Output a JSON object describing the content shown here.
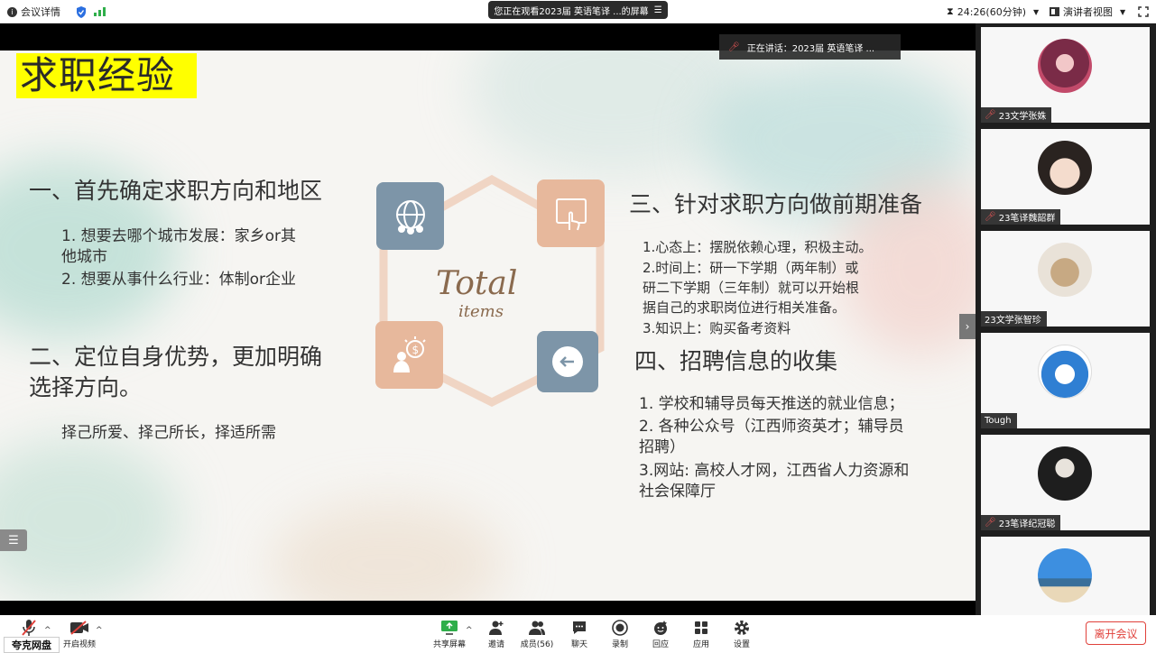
{
  "topbar": {
    "meeting_info": "会议详情",
    "notice": "您正在观看2023届 英语笔译 ...的屏幕",
    "timer": "24:26(60分钟)",
    "view_mode": "演讲者视图"
  },
  "speaker_pill": "正在讲话：2023届 英语笔译 ...",
  "slide": {
    "title": "求职经验",
    "sec1_heading": "一、首先确定求职方向和地区",
    "sec1_line1": "1. 想要去哪个城市发展：家乡or其",
    "sec1_line1b": "他城市",
    "sec1_line2": "2. 想要从事什么行业：体制or企业",
    "sec2_heading_a": "二、定位自身优势，更加明确",
    "sec2_heading_b": "选择方向。",
    "sec2_body": "择己所爱、择己所长，择适所需",
    "center_total": "Total",
    "center_items": "items",
    "sec3_heading": "三、针对求职方向做前期准备",
    "sec3_l1": "1.心态上：摆脱依赖心理，积极主动。",
    "sec3_l2": "2.时间上：研一下学期（两年制）或",
    "sec3_l3": "研二下学期（三年制）就可以开始根",
    "sec3_l4": "据自己的求职岗位进行相关准备。",
    "sec3_l5": "3.知识上：购买备考资料",
    "sec4_heading": "四、招聘信息的收集",
    "sec4_l1": "1. 学校和辅导员每天推送的就业信息；",
    "sec4_l2": "2. 各种公众号（江西师资英才；辅导员",
    "sec4_l2b": "招聘）",
    "sec4_l3": "3.网站: 高校人才网，江西省人力资源和",
    "sec4_l3b": "社会保障厅"
  },
  "participants": [
    {
      "name": "23文学张姝"
    },
    {
      "name": "23笔译魏韶群"
    },
    {
      "name": "23文学张智珍"
    },
    {
      "name": "Tough"
    },
    {
      "name": "23笔译纪冠聪"
    },
    {
      "name": ""
    }
  ],
  "toolbar": {
    "mute": "",
    "video": "开启视频",
    "share": "共享屏幕",
    "invite": "邀请",
    "members": "成员(56)",
    "chat": "聊天",
    "record": "录制",
    "react": "回应",
    "apps": "应用",
    "settings": "设置",
    "leave": "离开会议",
    "quark": "夸克网盘"
  },
  "colors": {
    "title_highlight": "#ffff00",
    "leave_red": "#e0413b",
    "tile_blue": "#7d95a8",
    "tile_peach": "#e7b89c"
  }
}
